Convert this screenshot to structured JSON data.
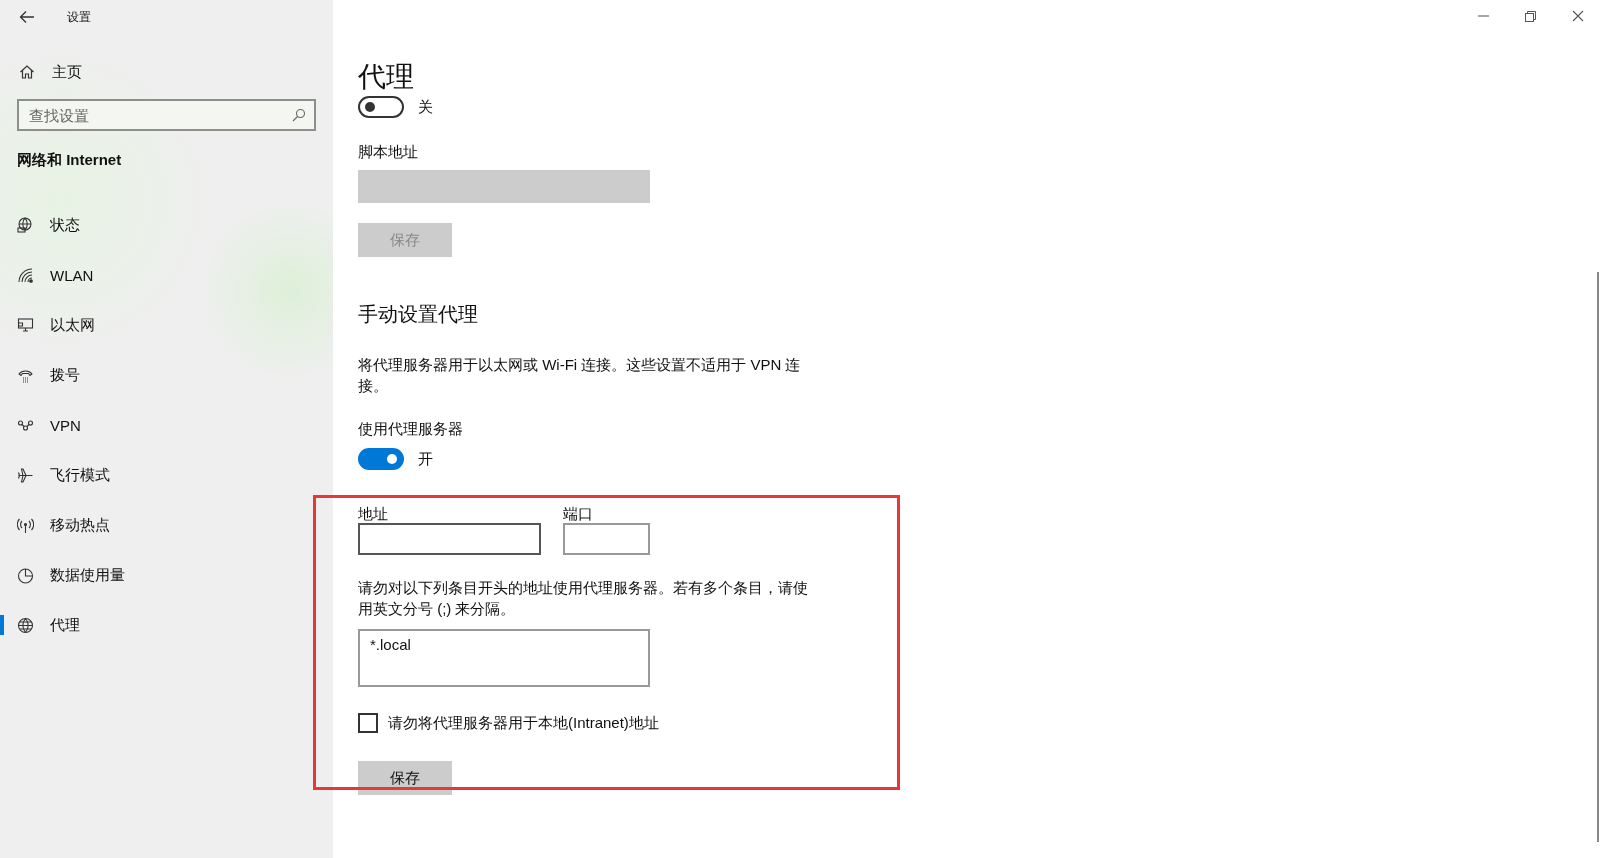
{
  "window": {
    "title": "设置"
  },
  "sidebar": {
    "home": "主页",
    "search_placeholder": "查找设置",
    "section": "网络和 Internet",
    "items": [
      {
        "kind": "status",
        "label": "状态",
        "selected": false
      },
      {
        "kind": "wifi",
        "label": "WLAN",
        "selected": false
      },
      {
        "kind": "ethernet",
        "label": "以太网",
        "selected": false
      },
      {
        "kind": "dialup",
        "label": "拨号",
        "selected": false
      },
      {
        "kind": "vpn",
        "label": "VPN",
        "selected": false
      },
      {
        "kind": "airplane",
        "label": "飞行模式",
        "selected": false
      },
      {
        "kind": "hotspot",
        "label": "移动热点",
        "selected": false
      },
      {
        "kind": "data",
        "label": "数据使用量",
        "selected": false
      },
      {
        "kind": "globe",
        "label": "代理",
        "selected": true
      }
    ]
  },
  "content": {
    "title": "代理",
    "auto_toggle": {
      "on": false,
      "label": "关"
    },
    "script_address": {
      "label": "脚本地址",
      "disabled": true
    },
    "script_save": {
      "label": "保存",
      "disabled": true
    },
    "manual": {
      "heading": "手动设置代理",
      "description": "将代理服务器用于以太网或 Wi-Fi 连接。这些设置不适用于 VPN 连接。",
      "use_label": "使用代理服务器",
      "toggle": {
        "on": true,
        "label": "开"
      },
      "address_label": "地址",
      "port_label": "端口",
      "exceptions_note": "请勿对以下列条目开头的地址使用代理服务器。若有多个条目，请使用英文分号 (;) 来分隔。",
      "exceptions_value": "*.local",
      "bypass_local": {
        "label": "请勿将代理服务器用于本地(Intranet)地址",
        "checked": false
      },
      "save": {
        "label": "保存",
        "disabled": false
      }
    }
  }
}
